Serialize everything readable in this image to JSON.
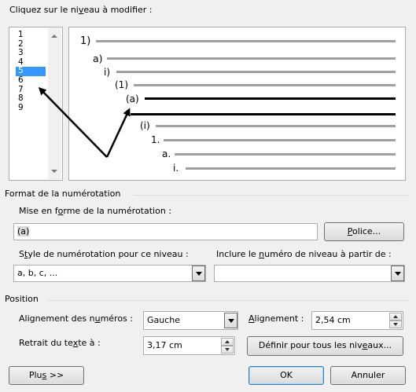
{
  "header": {
    "label_pre": "Cliquez sur le ni",
    "label_key": "v",
    "label_post": "eau à modifier :"
  },
  "levels": [
    "1",
    "2",
    "3",
    "4",
    "5",
    "6",
    "7",
    "8",
    "9"
  ],
  "selected_level": "5",
  "preview": {
    "labels": [
      "1)",
      "a)",
      "i)",
      "(1)",
      "(a)",
      "(i)",
      "1.",
      "a.",
      "i."
    ]
  },
  "format_section": {
    "title": "Format de la numérotation",
    "mise_label_pre": "Mise en f",
    "mise_label_key": "o",
    "mise_label_post": "rme de la numérotation :",
    "mise_value": "(a)",
    "police_key": "P",
    "police_rest": "olice...",
    "style_label_pre": "S",
    "style_label_key": "t",
    "style_label_post": "yle de numérotation pour ce niveau :",
    "style_value": "a, b, c, ...",
    "inclure_label_pre": "Inclure le ",
    "inclure_label_key": "n",
    "inclure_label_post": "uméro de niveau à partir de :",
    "inclure_value": ""
  },
  "position_section": {
    "title": "Position",
    "align_nums_pre": "Alignement des n",
    "align_nums_key": "u",
    "align_nums_post": "méros :",
    "align_nums_value": "Gauche",
    "alignement_key": "A",
    "alignement_rest": "lignement :",
    "alignement_value": "2,54 cm",
    "retrait_pre": "Retrait du te",
    "retrait_key": "x",
    "retrait_post": "te à :",
    "retrait_value": "3,17 cm",
    "definir_pre": "Définir pour tous les niv",
    "definir_key": "e",
    "definir_post": "aux..."
  },
  "buttons": {
    "plus_pre": "Plu",
    "plus_key": "s",
    "plus_post": " >>",
    "ok": "OK",
    "annuler": "Annuler"
  }
}
